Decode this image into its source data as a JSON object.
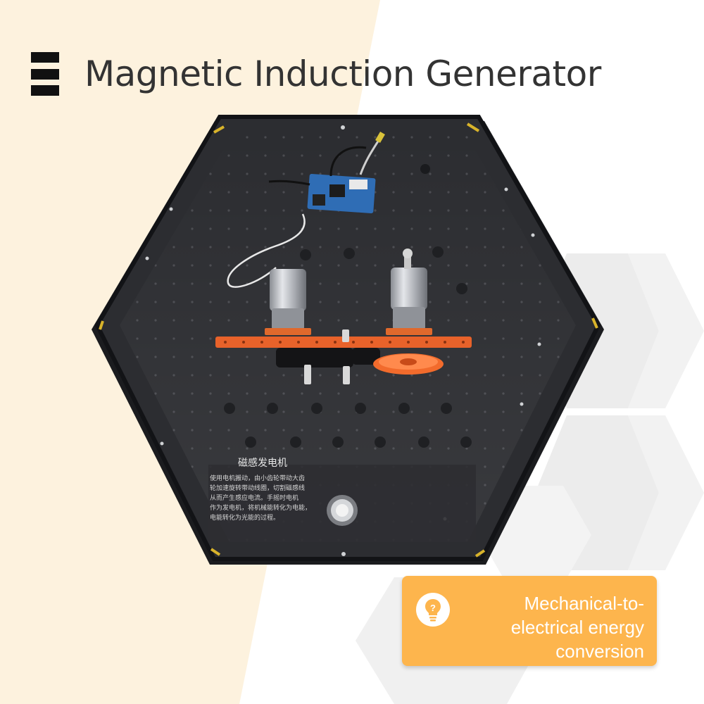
{
  "header": {
    "menu_icon": "hamburger-menu-icon",
    "title": "Magnetic Induction Generator"
  },
  "product_image": {
    "panel_label": "磁感发电机",
    "panel_description": [
      "使用电机搬动，由小齿轮带动大齿",
      "轮加速旋转带动线圈，切割磁感线",
      "从而产生感应电流。手摇时电机",
      "作为发电机，将机械能转化为电能，",
      "电能转化为光能的过程。"
    ]
  },
  "callout": {
    "icon": "lightbulb-icon",
    "text": "Mechanical-to-electrical energy conversion"
  },
  "colors": {
    "background_left": "#fdf2de",
    "background_right": "#ffffff",
    "hex_pattern": "#ebebeb",
    "panel": "#2a2b2e",
    "gear_rail": "#e8622a",
    "badge": "#fdb54d",
    "title_text": "#333333"
  }
}
